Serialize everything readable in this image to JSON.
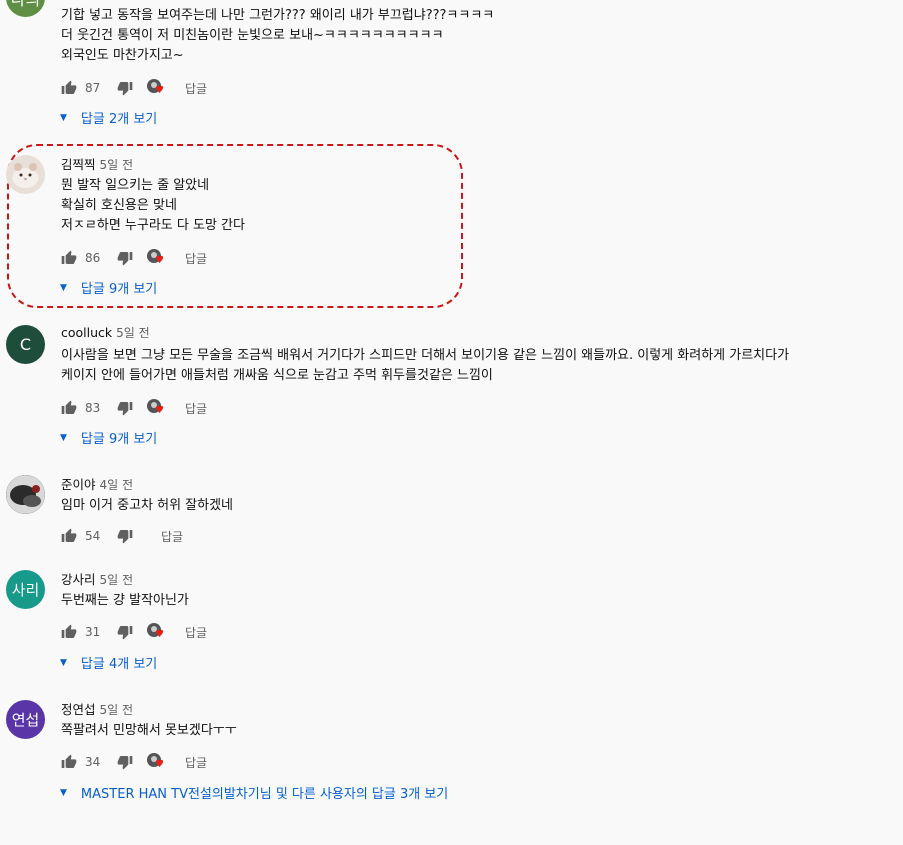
{
  "comments": [
    {
      "avatar_text": "나의",
      "avatar_color": "#5e8f45",
      "lines": [
        "기합 넣고 동작을 보여주는데 나만 그런가??? 왜이리 내가 부끄럽냐???ㅋㅋㅋㅋ",
        "더 웃긴건 통역이 저 미친놈이란 눈빛으로 보내~ㅋㅋㅋㅋㅋㅋㅋㅋㅋㅋ",
        "외국인도 마찬가지고~"
      ],
      "likes": "87",
      "reply_label": "답글",
      "replies_label": "답글 2개 보기"
    },
    {
      "author": "김찍찍",
      "time": "5일 전",
      "lines": [
        "뭔 발작 일으키는 줄 알았네",
        "확실히 호신용은 맞네",
        "저ㅈㄹ하면 누구라도 다 도망 간다"
      ],
      "likes": "86",
      "reply_label": "답글",
      "replies_label": "답글 9개 보기"
    },
    {
      "avatar_text": "C",
      "avatar_color": "#1e4d3c",
      "author": "coolluck",
      "time": "5일 전",
      "lines": [
        "이사람을 보면 그냥 모든 무술을 조금씩 배워서 거기다가 스피드만 더해서 보이기용 같은 느낌이 왜들까요. 이렇게 화려하게 가르치다가",
        "케이지 안에 들어가면 애들처럼 개싸움 식으로 눈감고 주먹 휘두를것같은 느낌이"
      ],
      "likes": "83",
      "reply_label": "답글",
      "replies_label": "답글 9개 보기"
    },
    {
      "author": "준이야",
      "time": "4일 전",
      "lines": [
        "임마 이거 중고차 허위 잘하겠네"
      ],
      "likes": "54",
      "reply_label": "답글"
    },
    {
      "avatar_text": "사리",
      "avatar_color": "#179a8a",
      "author": "강사리",
      "time": "5일 전",
      "lines": [
        "두번째는 걍 발작아닌가"
      ],
      "likes": "31",
      "reply_label": "답글",
      "replies_label": "답글 4개 보기"
    },
    {
      "avatar_text": "연섭",
      "avatar_color": "#5a35a8",
      "author": "정연섭",
      "time": "5일 전",
      "lines": [
        "쪽팔려서 민망해서 못보겠다ㅜㅜ"
      ],
      "likes": "34",
      "reply_label": "답글",
      "replies_label": "MASTER HAN TV전설의발차기님 및 다른 사용자의 답글 3개 보기"
    }
  ]
}
